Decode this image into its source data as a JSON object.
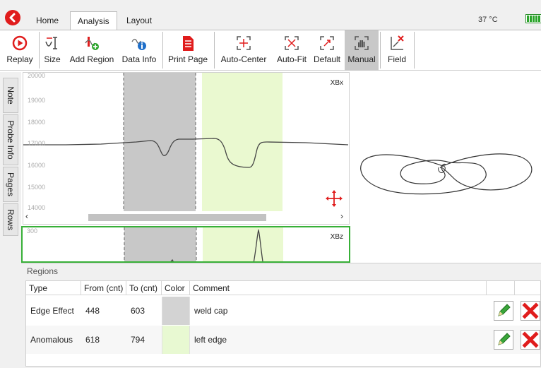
{
  "tabs": [
    {
      "label": "Home"
    },
    {
      "label": "Analysis"
    },
    {
      "label": "Layout"
    }
  ],
  "status": {
    "temperature": "37 °C",
    "battery_level": 1.0
  },
  "toolbar": {
    "replay": "Replay",
    "size": "Size",
    "add_region": "Add Region",
    "data_info": "Data Info",
    "print_page": "Print Page",
    "auto_center": "Auto-Center",
    "auto_fit": "Auto-Fit",
    "default": "Default",
    "manual": "Manual",
    "field": "Field"
  },
  "side_tabs": [
    "Note",
    "Probe Info",
    "Pages",
    "Rows"
  ],
  "plot_top": {
    "label": "XBx",
    "y_ticks": [
      "20000",
      "19000",
      "18000",
      "17000",
      "16000",
      "15000",
      "14000"
    ]
  },
  "plot_bottom": {
    "label": "XBz",
    "y_tick": "300"
  },
  "regions": {
    "title": "Regions",
    "columns": [
      "Type",
      "From (cnt)",
      "To (cnt)",
      "Color",
      "Comment"
    ],
    "rows": [
      {
        "type": "Edge Effect",
        "from": "448",
        "to": "603",
        "color": "#d3d3d3",
        "comment": "weld cap"
      },
      {
        "type": "Anomalous",
        "from": "618",
        "to": "794",
        "color": "#e8f9d2",
        "comment": "left edge"
      }
    ]
  },
  "colors": {
    "accent_red": "#e01c1c",
    "selection_green": "#38b038",
    "region_gray": "#c8c8c8",
    "region_green": "#eaf9d0"
  }
}
